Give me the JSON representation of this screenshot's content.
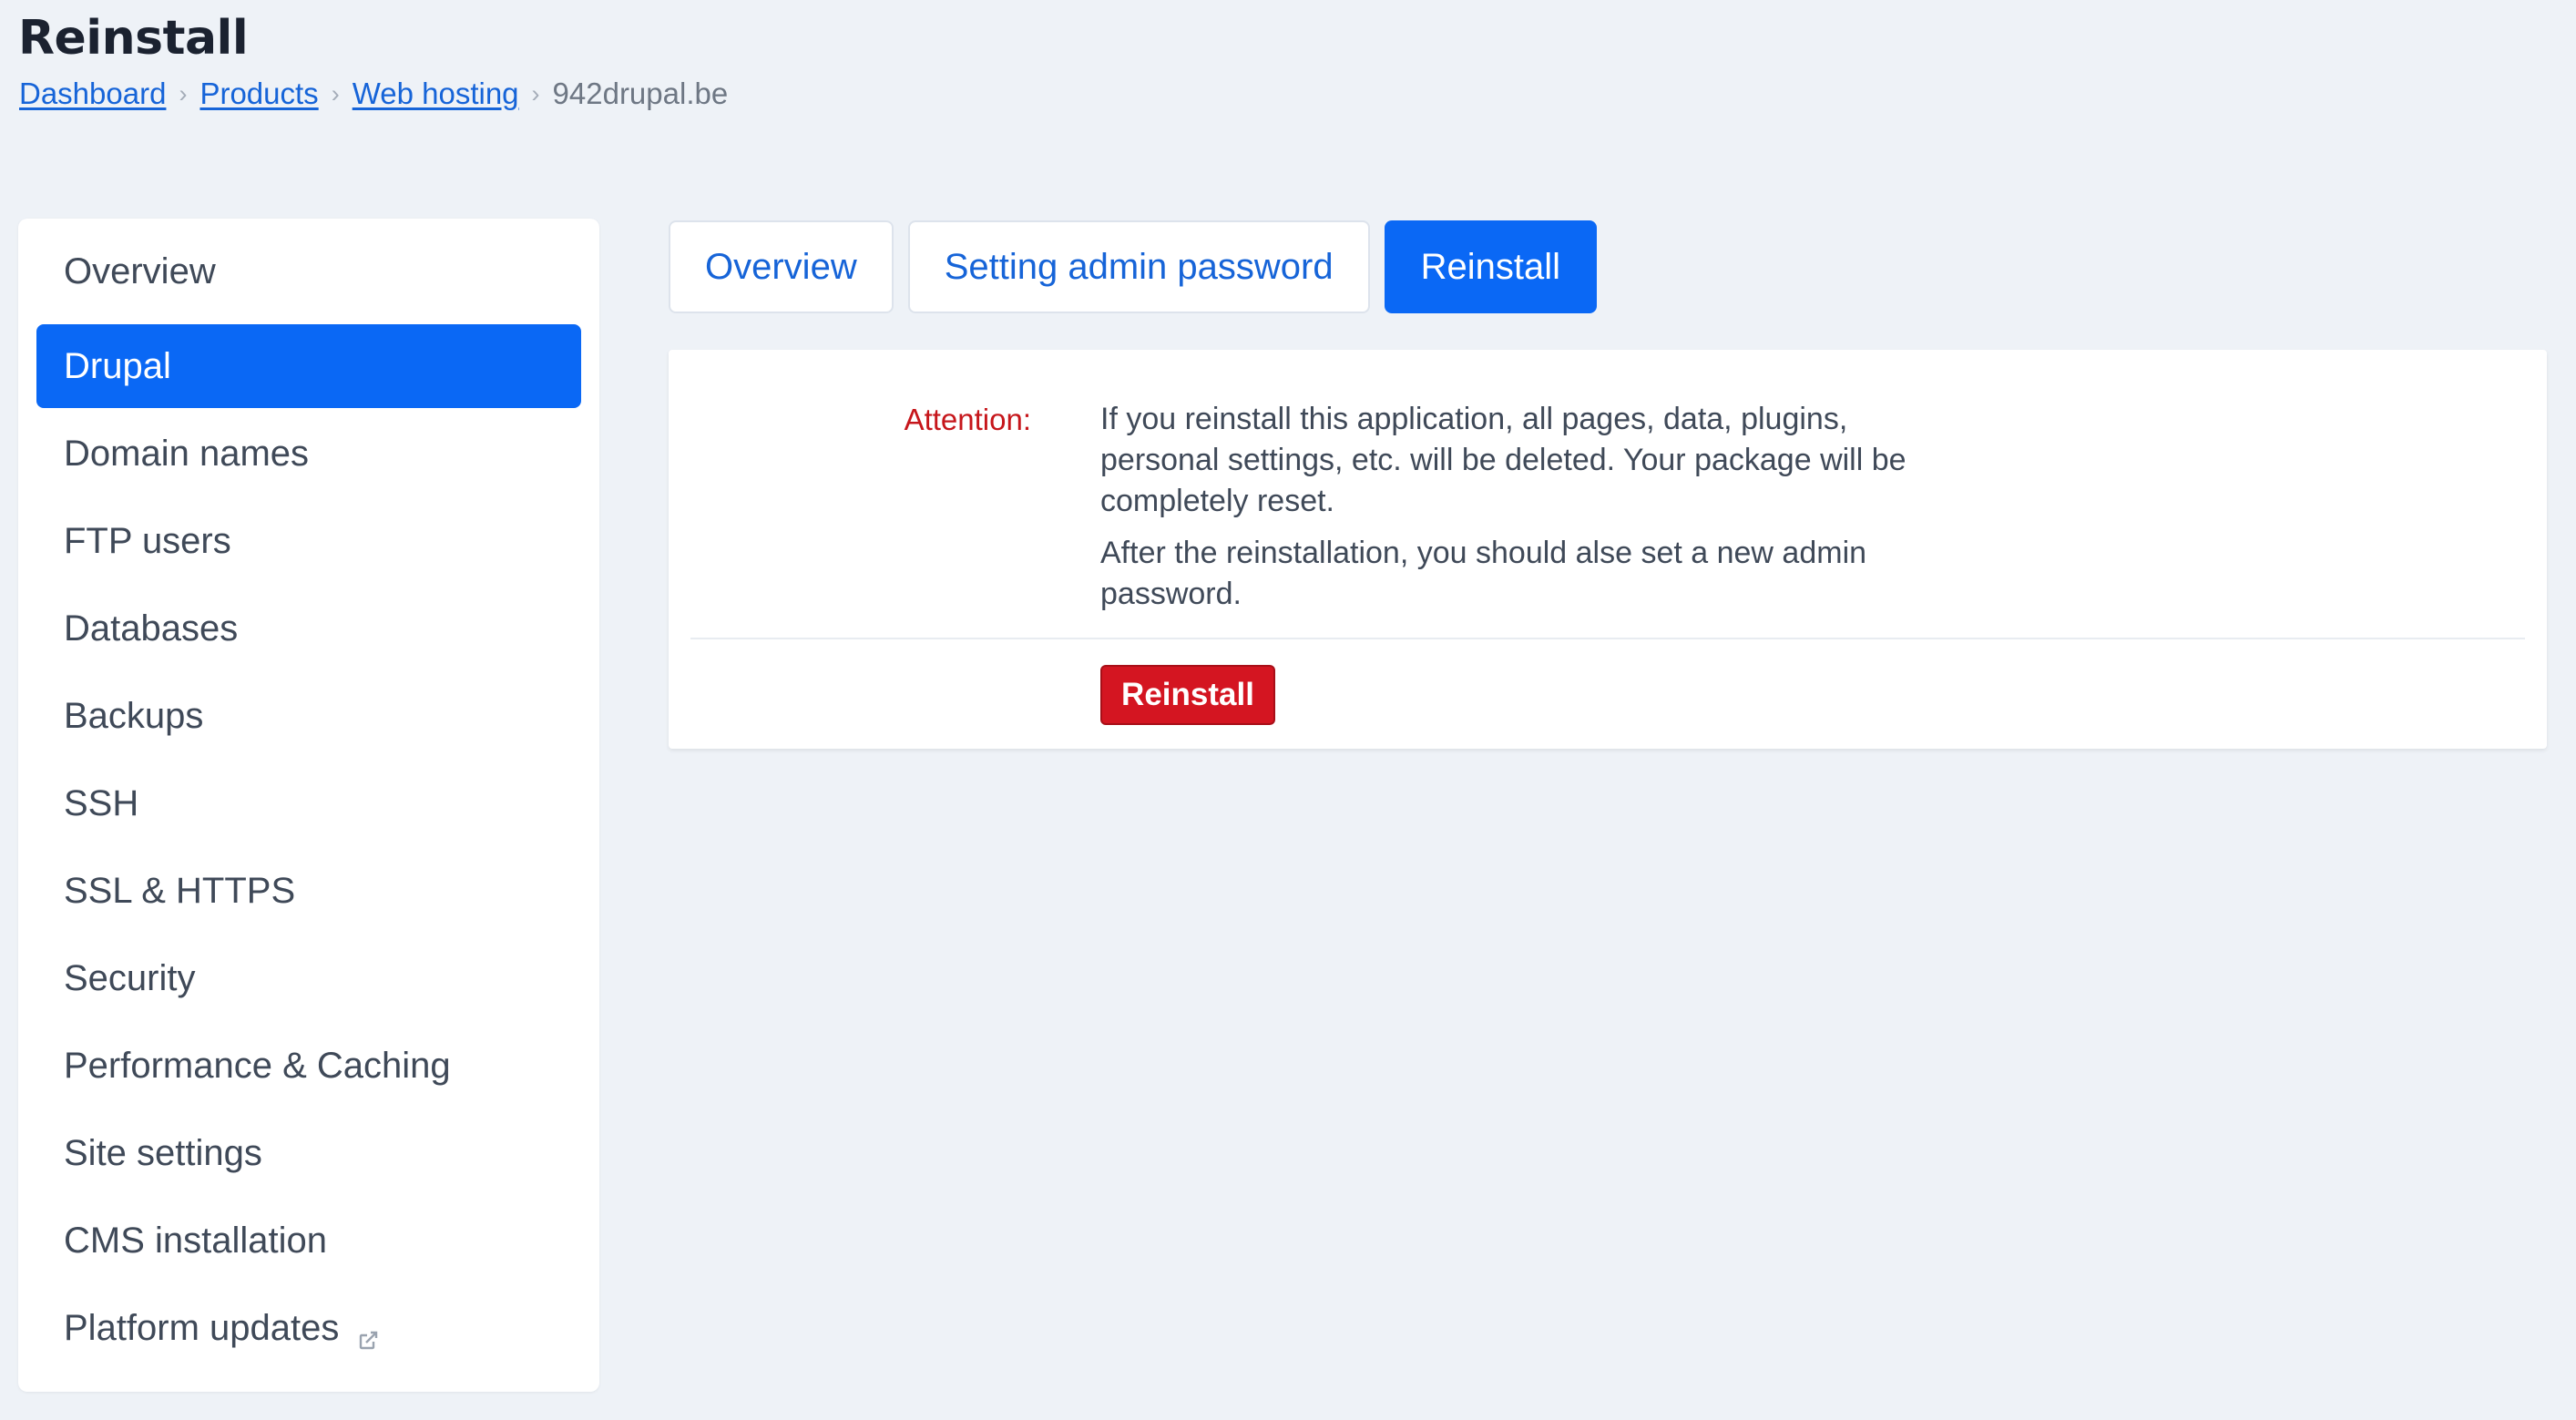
{
  "page": {
    "title": "Reinstall"
  },
  "breadcrumb": {
    "items": [
      "Dashboard",
      "Products",
      "Web hosting"
    ],
    "current": "942drupal.be",
    "separator": "›"
  },
  "sidebar": {
    "items": [
      {
        "label": "Overview"
      },
      {
        "label": "Drupal",
        "active": true
      },
      {
        "label": "Domain names"
      },
      {
        "label": "FTP users"
      },
      {
        "label": "Databases"
      },
      {
        "label": "Backups"
      },
      {
        "label": "SSH"
      },
      {
        "label": "SSL & HTTPS"
      },
      {
        "label": "Security"
      },
      {
        "label": "Performance & Caching"
      },
      {
        "label": "Site settings"
      },
      {
        "label": "CMS installation"
      },
      {
        "label": "Platform updates",
        "icon": "external-link-icon"
      }
    ]
  },
  "tabs": [
    {
      "label": "Overview"
    },
    {
      "label": "Setting admin password"
    },
    {
      "label": "Reinstall",
      "active": true
    }
  ],
  "panel": {
    "attention_label": "Attention:",
    "warning_text": "If you reinstall this application, all pages, data, plugins, personal settings, etc. will be deleted. Your package will be completely reset.",
    "note_text": "After the reinstallation, you should alse set a new admin password.",
    "button_label": "Reinstall"
  },
  "colors": {
    "accent": "#0a68f5",
    "link": "#1664d8",
    "danger": "#d41521",
    "attention": "#c6161b",
    "background": "#eef2f7"
  }
}
